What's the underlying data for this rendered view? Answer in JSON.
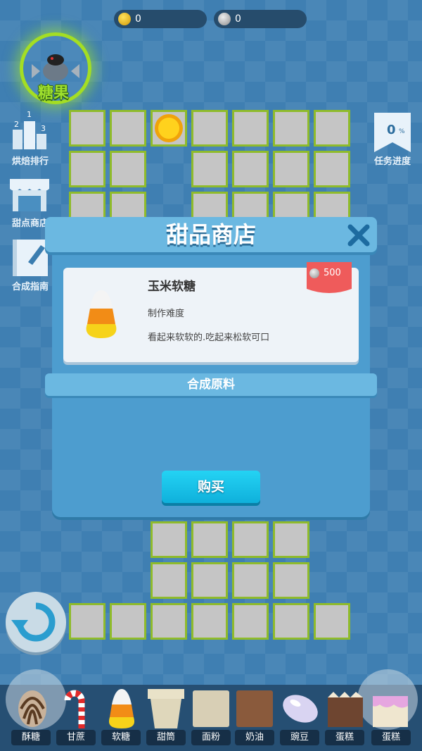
{
  "hud": {
    "gold_coins": "0",
    "silver_coins": "0",
    "candy_label": "糖果"
  },
  "side_menu": {
    "ranking": {
      "label": "烘焙排行",
      "rank1": "1",
      "rank2": "2",
      "rank3": "3"
    },
    "dessert_shop": {
      "label": "甜点商店"
    },
    "guide": {
      "label": "合成指南"
    },
    "task_progress": {
      "label": "任务进度",
      "value": "0",
      "unit": "%"
    }
  },
  "modal": {
    "title": "甜品商店",
    "item": {
      "name": "玉米软糖",
      "difficulty_label": "制作难度",
      "description": "看起来软软的.吃起来松软可口",
      "price": "500"
    },
    "section_label": "合成原料",
    "buy_label": "购买"
  },
  "bottom_bar": {
    "items": [
      {
        "label": "酥糖",
        "icon": "striped-candy-icon"
      },
      {
        "label": "甘蔗",
        "icon": "candy-cane-icon"
      },
      {
        "label": "软糖",
        "icon": "candy-corn-icon"
      },
      {
        "label": "甜筒",
        "icon": "cone-icon"
      },
      {
        "label": "面粉",
        "icon": "flour-icon"
      },
      {
        "label": "奶油",
        "icon": "cream-icon"
      },
      {
        "label": "豌豆",
        "icon": "bean-icon"
      },
      {
        "label": "蛋糕",
        "icon": "cake-icon"
      },
      {
        "label": "蛋糕",
        "icon": "pink-cake-icon"
      }
    ]
  },
  "colors": {
    "background": "#3f7fb2",
    "tile_border": "#8fbb2b",
    "modal_header": "#6bb8e1",
    "buy_button": "#1cc4ea",
    "price_ribbon": "#ef5b5b"
  }
}
